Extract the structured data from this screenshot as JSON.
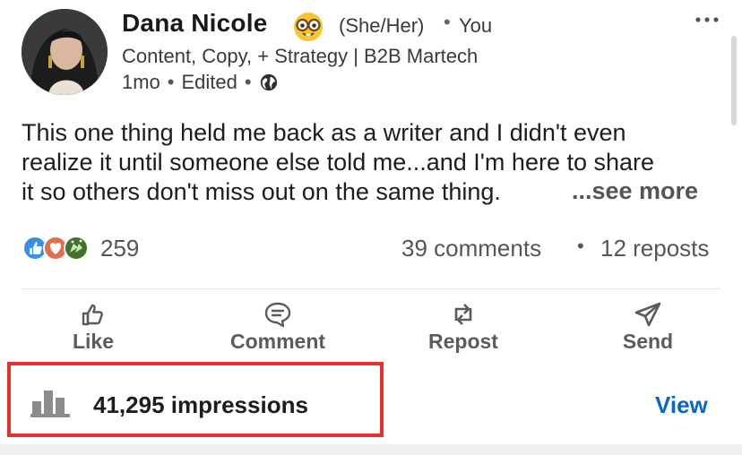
{
  "author": {
    "name": "Dana Nicole",
    "pronouns": "(She/Her)",
    "separator": "•",
    "relation": "You",
    "headline": "Content, Copy, + Strategy | B2B Martech",
    "time": "1mo",
    "edited": "Edited",
    "visibility_icon": "globe-icon",
    "badge_icon": "nerd-face-emoji"
  },
  "menu_icon": "more-horizontal-icon",
  "post": {
    "lines": [
      "This one thing held me back as a writer and I didn't even",
      "realize it until someone else told me...and I'm here to share",
      "it so others don't miss out on the same thing."
    ],
    "see_more": "...see more"
  },
  "social": {
    "reaction_icons": [
      "like-reaction-icon",
      "love-reaction-icon",
      "celebrate-reaction-icon"
    ],
    "reactions": "259",
    "comments": "39 comments",
    "separator": "•",
    "reposts": "12 reposts"
  },
  "actions": [
    {
      "label": "Like",
      "icon": "thumbs-up-icon"
    },
    {
      "label": "Comment",
      "icon": "comment-icon"
    },
    {
      "label": "Repost",
      "icon": "repost-icon"
    },
    {
      "label": "Send",
      "icon": "send-icon"
    }
  ],
  "analytics": {
    "impressions": "41,295 impressions",
    "view_label": "View",
    "icon": "bar-chart-icon"
  },
  "colors": {
    "link_blue": "#0a66c2",
    "highlight_red": "#e8302e",
    "text_gray": "#555555"
  }
}
